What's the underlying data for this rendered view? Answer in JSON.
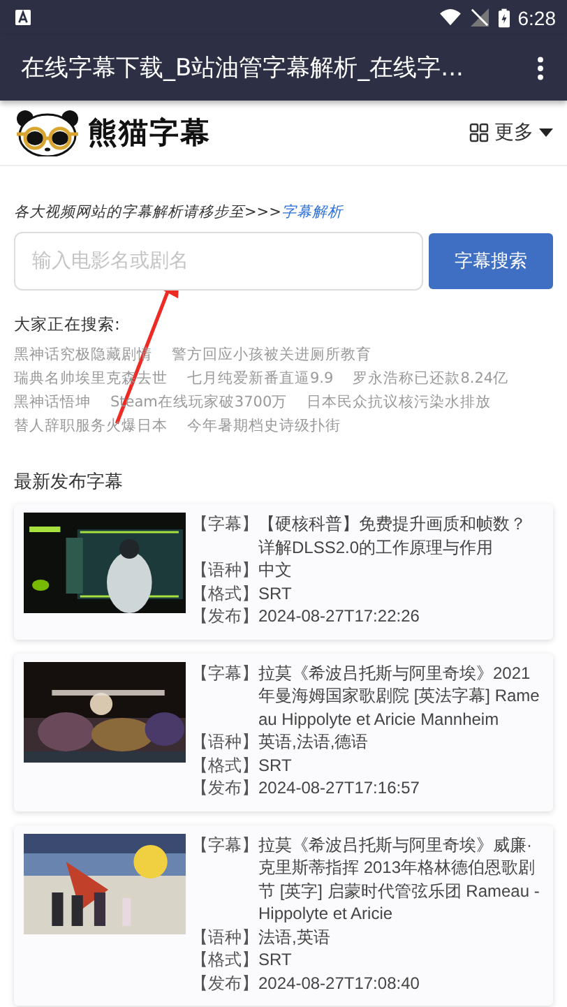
{
  "status_bar": {
    "time": "6:28"
  },
  "app_bar": {
    "title": "在线字幕下载_B站油管字幕解析_在线字..."
  },
  "header": {
    "logo_text": "熊猫字幕",
    "more_label": "更多"
  },
  "notice": {
    "text": "各大视频网站的字幕解析请移步至>>>",
    "link": "字幕解析"
  },
  "search": {
    "placeholder": "输入电影名或剧名",
    "button": "字幕搜索"
  },
  "hot": {
    "title": "大家正在搜索:",
    "rows": [
      [
        "黑神话究极隐藏剧情",
        "警方回应小孩被关进厕所教育"
      ],
      [
        "瑞典名帅埃里克森去世",
        "七月纯爱新番直逼9.9",
        "罗永浩称已还款8.24亿"
      ],
      [
        "黑神话悟坤",
        "Steam在线玩家破3700万",
        "日本民众抗议核污染水排放"
      ],
      [
        "替人辞职服务火爆日本",
        "今年暑期档史诗级扑街"
      ]
    ]
  },
  "latest": {
    "title": "最新发布字幕",
    "items": [
      {
        "fields": [
          {
            "label": "【字幕】",
            "value": "【硬核科普】免费提升画质和帧数？详解DLSS2.0的工作原理与作用"
          },
          {
            "label": "【语种】",
            "value": "中文"
          },
          {
            "label": "【格式】",
            "value": "SRT"
          },
          {
            "label": "【发布】",
            "value": "2024-08-27T17:22:26"
          }
        ]
      },
      {
        "fields": [
          {
            "label": "【字幕】",
            "value": "拉莫《希波吕托斯与阿里奇埃》2021年曼海姆国家歌剧院 [英法字幕] Rameau Hippolyte et Aricie Mannheim"
          },
          {
            "label": "【语种】",
            "value": "英语,法语,德语"
          },
          {
            "label": "【格式】",
            "value": "SRT"
          },
          {
            "label": "【发布】",
            "value": "2024-08-27T17:16:57"
          }
        ]
      },
      {
        "fields": [
          {
            "label": "【字幕】",
            "value": "拉莫《希波吕托斯与阿里奇埃》威廉·克里斯蒂指挥 2013年格林德伯恩歌剧节 [英字] 启蒙时代管弦乐团 Rameau - Hippolyte et Aricie"
          },
          {
            "label": "【语种】",
            "value": "法语,英语"
          },
          {
            "label": "【格式】",
            "value": "SRT"
          },
          {
            "label": "【发布】",
            "value": "2024-08-27T17:08:40"
          }
        ]
      }
    ]
  }
}
